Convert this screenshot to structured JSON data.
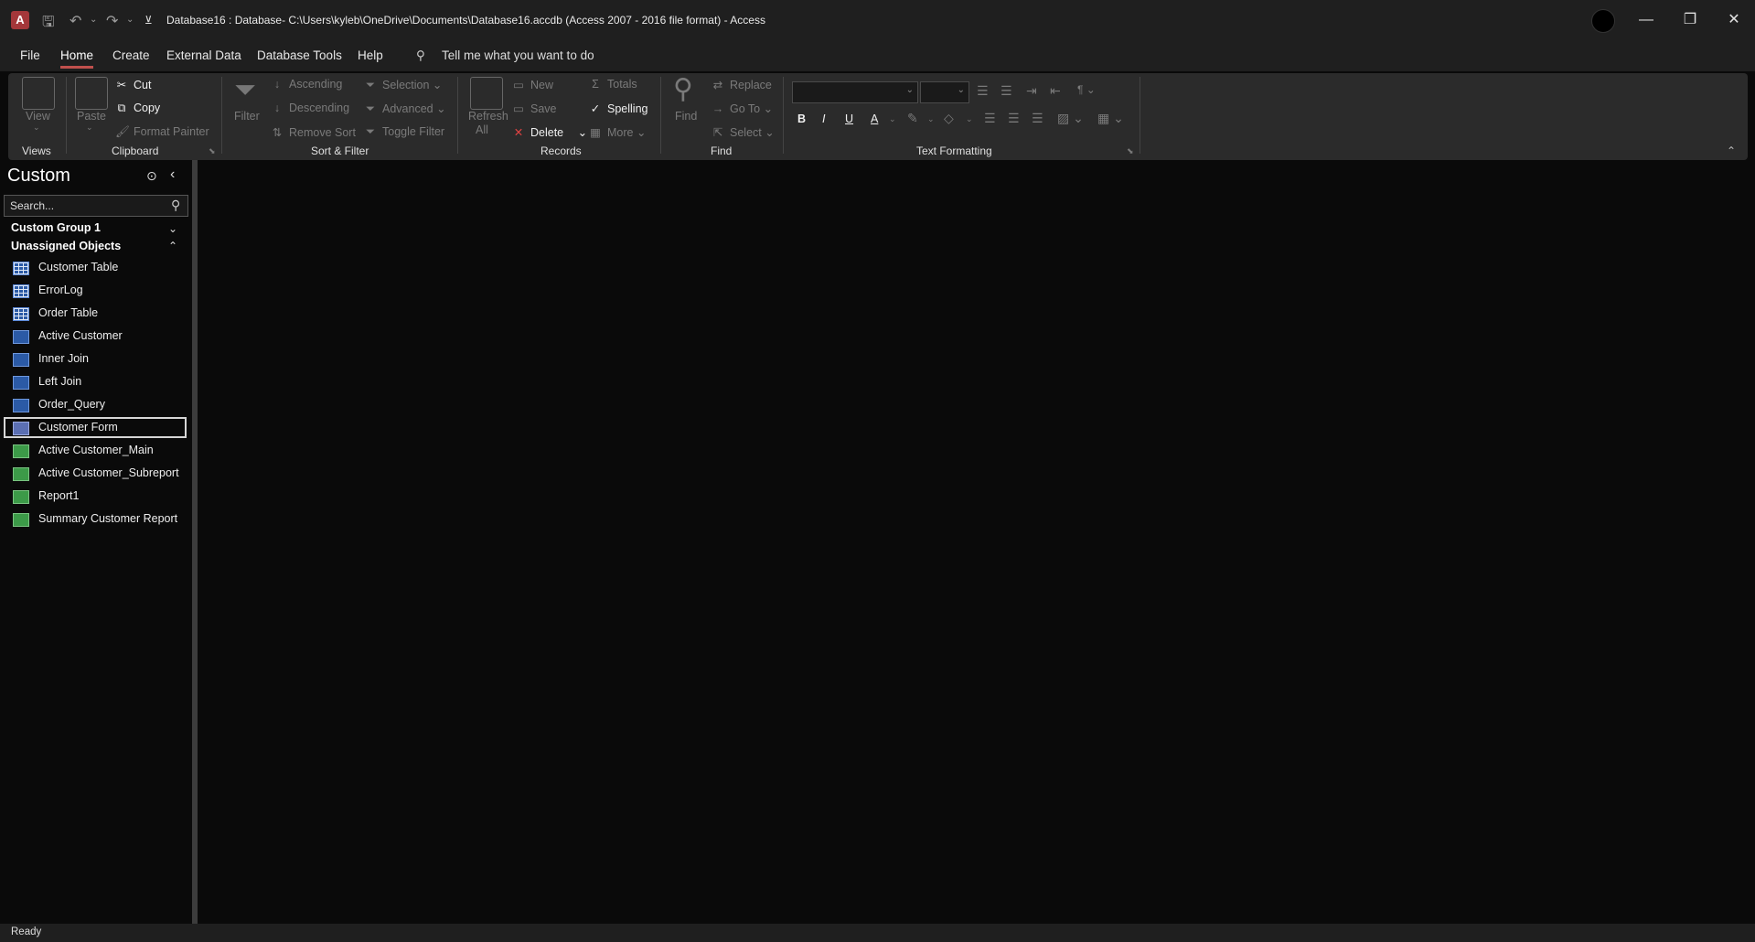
{
  "window": {
    "title": "Database16 : Database- C:\\Users\\kyleb\\OneDrive\\Documents\\Database16.accdb (Access 2007 - 2016 file format)  -  Access",
    "app_logo": "A",
    "minimize": "—",
    "restore": "❐",
    "close": "✕"
  },
  "tabs": [
    "File",
    "Home",
    "Create",
    "External Data",
    "Database Tools",
    "Help"
  ],
  "tell_me": "Tell me what you want to do",
  "ribbon": {
    "views": {
      "view": "View",
      "group": "Views"
    },
    "clipboard": {
      "paste": "Paste",
      "cut": "Cut",
      "copy": "Copy",
      "format_painter": "Format Painter",
      "group": "Clipboard"
    },
    "sort_filter": {
      "filter": "Filter",
      "ascending": "Ascending",
      "descending": "Descending",
      "remove_sort": "Remove Sort",
      "selection": "Selection",
      "advanced": "Advanced",
      "toggle_filter": "Toggle Filter",
      "group": "Sort & Filter"
    },
    "records": {
      "refresh": "Refresh",
      "refresh_all": "All",
      "new": "New",
      "save": "Save",
      "delete": "Delete",
      "totals": "Totals",
      "spelling": "Spelling",
      "more": "More",
      "group": "Records"
    },
    "find": {
      "find": "Find",
      "replace": "Replace",
      "go_to": "Go To",
      "select": "Select",
      "group": "Find"
    },
    "text_formatting": {
      "bold": "B",
      "italic": "I",
      "underline": "U",
      "font_color": "A",
      "group": "Text Formatting"
    }
  },
  "nav": {
    "title": "Custom",
    "search_placeholder": "Search...",
    "group1": "Custom Group 1",
    "group2": "Unassigned Objects",
    "items": [
      {
        "label": "Customer Table",
        "type": "table"
      },
      {
        "label": "ErrorLog",
        "type": "table"
      },
      {
        "label": "Order Table",
        "type": "table"
      },
      {
        "label": "Active Customer",
        "type": "query"
      },
      {
        "label": "Inner Join",
        "type": "query"
      },
      {
        "label": "Left Join",
        "type": "query"
      },
      {
        "label": "Order_Query",
        "type": "query"
      },
      {
        "label": "Customer Form",
        "type": "form",
        "selected": true
      },
      {
        "label": "Active Customer_Main",
        "type": "report"
      },
      {
        "label": "Active Customer_Subreport",
        "type": "report"
      },
      {
        "label": "Report1",
        "type": "report"
      },
      {
        "label": "Summary Customer Report",
        "type": "report"
      }
    ]
  },
  "status": "Ready",
  "colors": {
    "accent": "#c0504d",
    "background": "#0a0a0a",
    "ribbon": "#2b2b2b",
    "titlebar": "#1f1f1f"
  }
}
